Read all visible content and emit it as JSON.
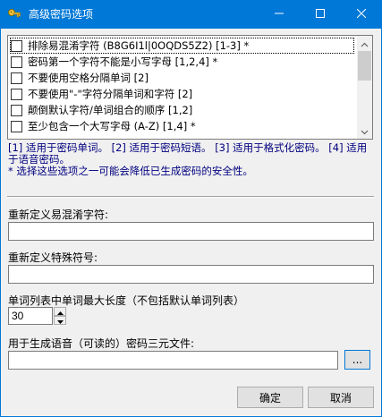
{
  "window": {
    "title": "高级密码选项",
    "accent": "#0078d7"
  },
  "options": [
    {
      "label": "排除易混淆字符 (B8G6I1l|0OQDS5Z2) [1-3] *",
      "checked": false
    },
    {
      "label": "密码第一个字符不能是小写字母 [1,2,4] *",
      "checked": false
    },
    {
      "label": "不要使用空格分隔单词 [2]",
      "checked": false
    },
    {
      "label": "不要使用\"-\"字符分隔单词和字符 [2]",
      "checked": false
    },
    {
      "label": "颠倒默认字符/单词组合的顺序 [1,2]",
      "checked": false
    },
    {
      "label": "至少包含一个大写字母 (A-Z) [1,4] *",
      "checked": false
    }
  ],
  "notes": {
    "line1": "[1] 适用于密码单词。 [2] 适用于密码短语。 [3] 适用于格式化密码。 [4] 适用于语音密码。",
    "line2": "* 选择这些选项之一可能会降低已生成密码的安全性。"
  },
  "fields": {
    "ambiguous_label": "重新定义易混淆字符:",
    "ambiguous_value": "",
    "special_label": "重新定义特殊符号:",
    "special_value": "",
    "maxlen_label": "单词列表中单词最大长度（不包括默认单词列表）",
    "maxlen_value": "30",
    "trigram_label": "用于生成语音（可读的）密码三元文件:",
    "trigram_value": "",
    "browse_label": "..."
  },
  "buttons": {
    "ok": "确定",
    "cancel": "取消"
  }
}
